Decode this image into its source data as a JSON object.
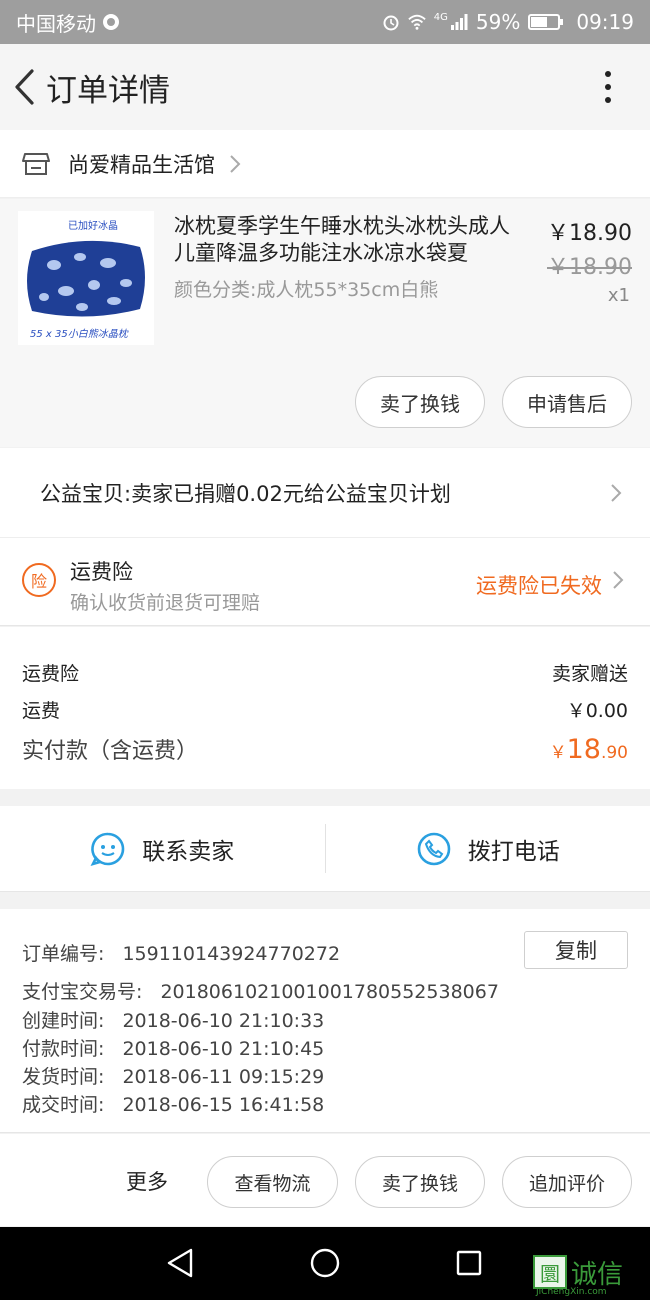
{
  "status_bar": {
    "carrier": "中国移动",
    "network": "4G",
    "battery": "59%",
    "battery_level": 0.59,
    "time": "09:19"
  },
  "header": {
    "title": "订单详情"
  },
  "shop": {
    "name": "尚爱精品生活馆"
  },
  "product": {
    "image_label_top": "已加好冰晶",
    "image_label_bottom": "55 x 35小白熊冰晶枕",
    "title": "冰枕夏季学生午睡水枕头冰枕头成人儿童降温多功能注水冰凉水袋夏",
    "sku": "颜色分类:成人枕55*35cm白熊",
    "price": "￥18.90",
    "original_price": "￥18.90",
    "quantity": "x1",
    "buttons": {
      "sell": "卖了换钱",
      "after_sale": "申请售后"
    }
  },
  "charity": {
    "text": "公益宝贝:卖家已捐赠0.02元给公益宝贝计划"
  },
  "insurance": {
    "icon_char": "险",
    "title": "运费险",
    "subtitle": "确认收货前退货可理赔",
    "status": "运费险已失效"
  },
  "fees": {
    "insurance_label": "运费险",
    "insurance_value": "卖家赠送",
    "shipping_label": "运费",
    "shipping_value": "￥0.00",
    "total_label": "实付款（含运费）",
    "total_currency": "￥",
    "total_int": "18",
    "total_dec": ".90"
  },
  "contact": {
    "seller": "联系卖家",
    "call": "拨打电话"
  },
  "order_info": {
    "copy": "复制",
    "rows": [
      {
        "label": "订单编号:",
        "value": "159110143924770272"
      },
      {
        "label": "支付宝交易号:",
        "value": "2018061021001001780552538067"
      },
      {
        "label": "创建时间:",
        "value": "2018-06-10 21:10:33"
      },
      {
        "label": "付款时间:",
        "value": "2018-06-10 21:10:45"
      },
      {
        "label": "发货时间:",
        "value": "2018-06-11 09:15:29"
      },
      {
        "label": "成交时间:",
        "value": "2018-06-15 16:41:58"
      }
    ]
  },
  "actions": {
    "more": "更多",
    "logistics": "查看物流",
    "sell": "卖了换钱",
    "review": "追加评价"
  },
  "watermark": {
    "box_char": "圜",
    "text": "诚信",
    "url": "JiChengXin.com"
  },
  "colors": {
    "accent": "#f06a20",
    "icon_blue": "#2aa0e0"
  }
}
